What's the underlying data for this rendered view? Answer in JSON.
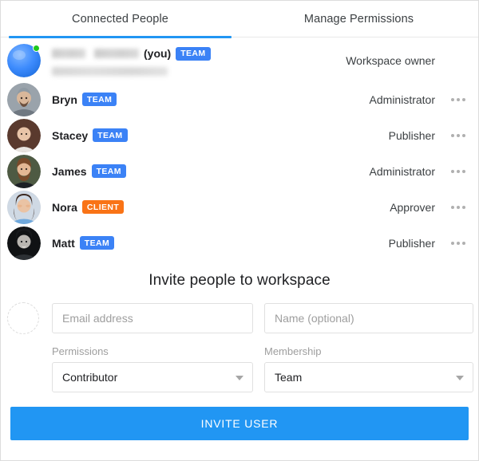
{
  "tabs": [
    {
      "label": "Connected People",
      "active": true
    },
    {
      "label": "Manage Permissions",
      "active": false
    }
  ],
  "people": [
    {
      "name": "",
      "name_redacted": true,
      "email_redacted": true,
      "you_label": "(you)",
      "badge": "TEAM",
      "badge_type": "team",
      "role": "Workspace owner",
      "has_menu": false,
      "online": true,
      "avatar": "blue-gradient"
    },
    {
      "name": "Bryn",
      "badge": "TEAM",
      "badge_type": "team",
      "role": "Administrator",
      "has_menu": true,
      "online": false,
      "avatar": "photo-bryn"
    },
    {
      "name": "Stacey",
      "badge": "TEAM",
      "badge_type": "team",
      "role": "Publisher",
      "has_menu": true,
      "online": false,
      "avatar": "photo-stacey"
    },
    {
      "name": "James",
      "badge": "TEAM",
      "badge_type": "team",
      "role": "Administrator",
      "has_menu": true,
      "online": false,
      "avatar": "photo-james"
    },
    {
      "name": "Nora",
      "badge": "CLIENT",
      "badge_type": "client",
      "role": "Approver",
      "has_menu": true,
      "online": false,
      "avatar": "photo-nora"
    },
    {
      "name": "Matt",
      "badge": "TEAM",
      "badge_type": "team",
      "role": "Publisher",
      "has_menu": true,
      "online": false,
      "avatar": "photo-matt"
    }
  ],
  "invite": {
    "title": "Invite people to workspace",
    "email_placeholder": "Email address",
    "email_value": "",
    "name_placeholder": "Name (optional)",
    "name_value": "",
    "permissions_label": "Permissions",
    "permissions_value": "Contributor",
    "membership_label": "Membership",
    "membership_value": "Team",
    "submit_label": "INVITE USER"
  },
  "colors": {
    "accent": "#2196f3",
    "badge_team": "#3b82f6",
    "badge_client": "#f97316",
    "online": "#1ec81e"
  }
}
